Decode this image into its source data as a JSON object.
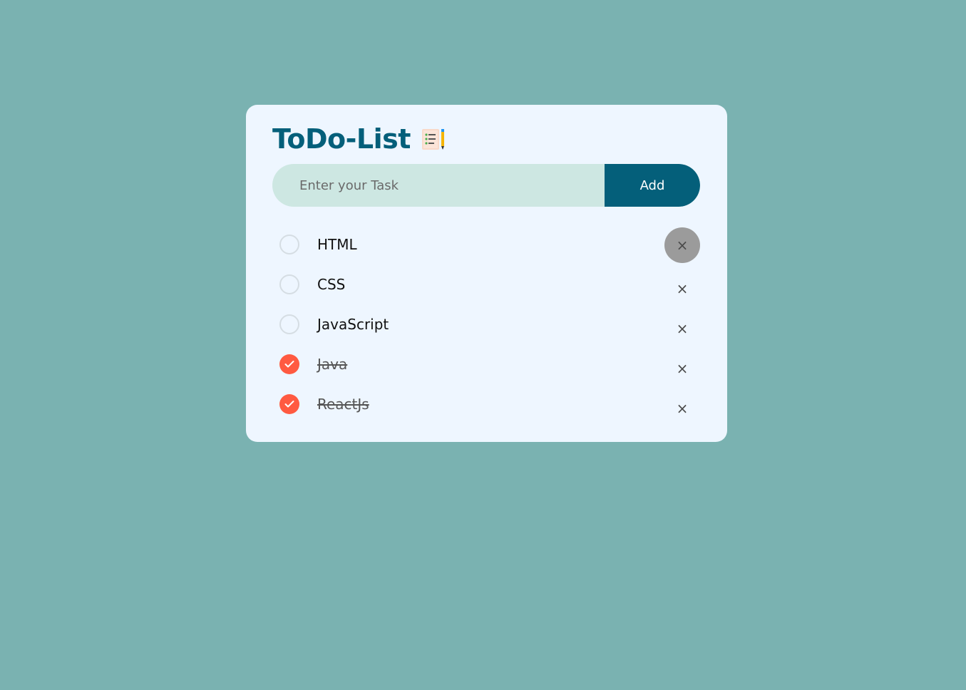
{
  "app": {
    "title": "ToDo-List",
    "title_icon": "notepad-icon"
  },
  "input": {
    "placeholder": "Enter your Task",
    "value": ""
  },
  "add_button": {
    "label": "Add"
  },
  "tasks": [
    {
      "label": "HTML",
      "done": false,
      "remove_label": "×"
    },
    {
      "label": "CSS",
      "done": false,
      "remove_label": "×"
    },
    {
      "label": "JavaScript",
      "done": false,
      "remove_label": "×"
    },
    {
      "label": "Java",
      "done": true,
      "remove_label": "×"
    },
    {
      "label": "ReactJs",
      "done": true,
      "remove_label": "×"
    }
  ],
  "colors": {
    "background": "#7ab2b1",
    "card": "#eef6ff",
    "accent": "#045f7a",
    "input_bg": "#cde7e2",
    "done": "#ff5a41"
  }
}
